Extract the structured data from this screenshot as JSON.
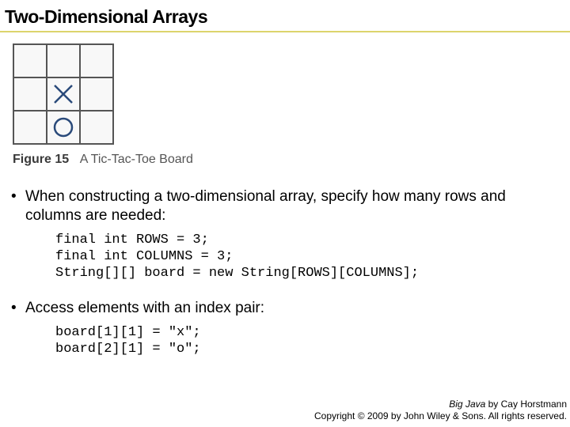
{
  "title": "Two-Dimensional Arrays",
  "figure": {
    "label": "Figure 15",
    "caption": "A Tic-Tac-Toe Board",
    "board": [
      [
        "",
        "",
        ""
      ],
      [
        "",
        "x",
        ""
      ],
      [
        "",
        "o",
        ""
      ]
    ]
  },
  "bullets": [
    {
      "text": "When constructing a two-dimensional array, specify how many rows and columns are needed:",
      "code": "final int ROWS = 3;\nfinal int COLUMNS = 3;\nString[][] board = new String[ROWS][COLUMNS];"
    },
    {
      "text": "Access elements with an index pair:",
      "code": "board[1][1] = \"x\";\nboard[2][1] = \"o\";"
    }
  ],
  "footer": {
    "book_title": "Big Java",
    "author": " by Cay Horstmann",
    "copyright": "Copyright © 2009 by John Wiley & Sons.  All rights reserved."
  }
}
